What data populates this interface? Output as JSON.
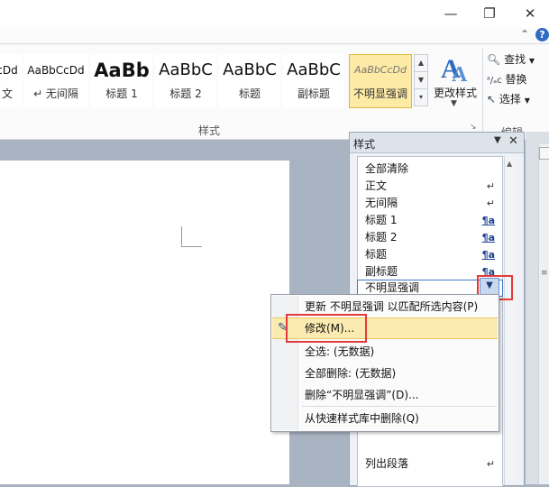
{
  "window": {
    "minimize_glyph": "—",
    "restore_glyph": "❐",
    "close_glyph": "✕",
    "collapse_ribbon_glyph": "⌃",
    "help_glyph": "?"
  },
  "ribbon": {
    "styles_gallery": [
      {
        "sample": "cDd",
        "name": "文"
      },
      {
        "sample": "AaBbCcDd",
        "name": "↵ 无间隔"
      },
      {
        "sample": "AaBb",
        "name": "标题 1"
      },
      {
        "sample": "AaBbC",
        "name": "标题 2"
      },
      {
        "sample": "AaBbC",
        "name": "标题"
      },
      {
        "sample": "AaBbC",
        "name": "副标题"
      },
      {
        "sample": "AaBbCcDd",
        "name": "不明显强调"
      }
    ],
    "change_styles_label": "更改样式",
    "styles_group_label": "样式",
    "editing_group_label": "编辑",
    "find_label": "查找",
    "replace_label": "替换",
    "select_label": "选择"
  },
  "styles_pane": {
    "title": "样式",
    "items": [
      {
        "label": "全部清除",
        "mark": ""
      },
      {
        "label": "正文",
        "mark": "↵"
      },
      {
        "label": "无间隔",
        "mark": "↵"
      },
      {
        "label": "标题 1",
        "mark": "¶a"
      },
      {
        "label": "标题 2",
        "mark": "¶a"
      },
      {
        "label": "标题",
        "mark": "¶a"
      },
      {
        "label": "副标题",
        "mark": "¶a"
      },
      {
        "label": "不明显强调",
        "mark": ""
      }
    ],
    "bottom_items": [
      {
        "label": "列出段落",
        "mark": "↵"
      }
    ]
  },
  "context_menu": {
    "items": [
      {
        "label": "更新 不明显强调 以匹配所选内容(P)"
      },
      {
        "label": "修改(M)..."
      },
      {
        "label": "全选: (无数据)"
      },
      {
        "label": "全部删除: (无数据)"
      },
      {
        "label": "删除“不明显强调”(D)..."
      },
      {
        "label": "从快速样式库中删除(Q)"
      }
    ]
  },
  "colors": {
    "highlight": "#fcebb0",
    "annotation_red": "#e23b3b",
    "selection_border": "#3c78c3"
  }
}
